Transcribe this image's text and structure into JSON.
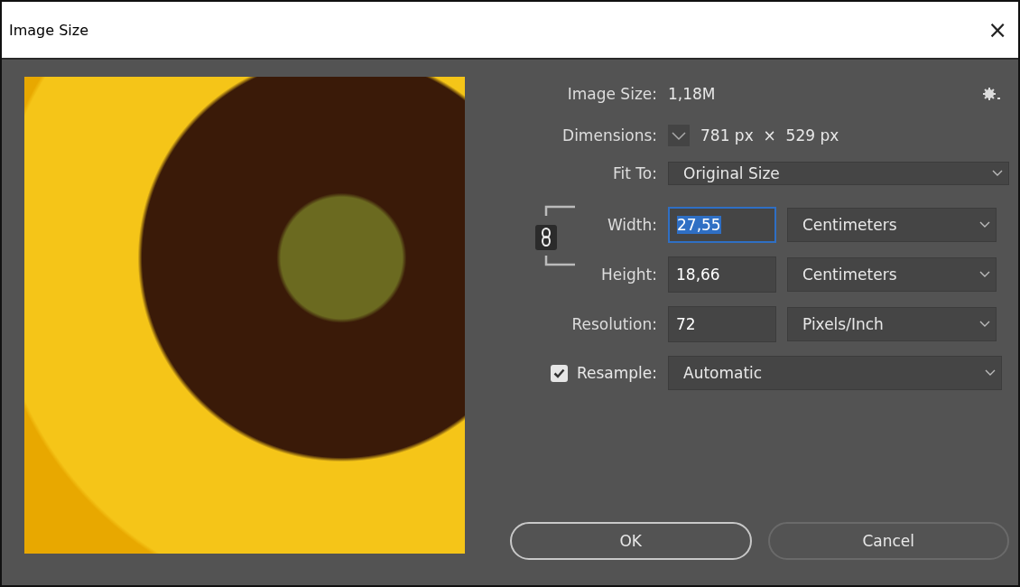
{
  "window": {
    "title": "Image Size",
    "close": "×"
  },
  "info": [
    {
      "label": "Image Size:",
      "value": "1,18M"
    },
    {
      "label": "Dimensions:",
      "value": "781 px  ×  529 px"
    }
  ],
  "fit_to": {
    "label": "Fit To:",
    "value": "Original Size"
  },
  "fields": [
    {
      "label": "Width:",
      "value": "27,55",
      "unit": "Centimeters",
      "focused": true
    },
    {
      "label": "Height:",
      "value": "18,66",
      "unit": "Centimeters",
      "focused": false
    },
    {
      "label": "Resolution:",
      "value": "72",
      "unit": "Pixels/Inch",
      "focused": false
    }
  ],
  "constrain_linked": true,
  "resample": {
    "label": "Resample:",
    "checked": true,
    "value": "Automatic"
  },
  "buttons": [
    {
      "label": "OK",
      "default": true
    },
    {
      "label": "Cancel",
      "default": false
    }
  ]
}
